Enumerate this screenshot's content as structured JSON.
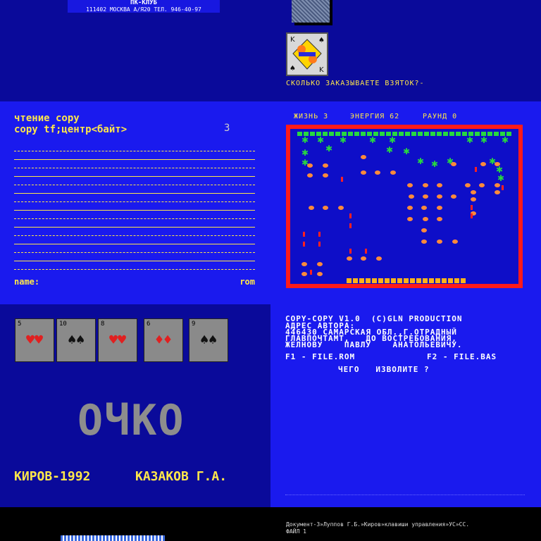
{
  "panel_pkclub": {
    "title": "ПК-КЛУБ",
    "address": "111402 МОСКВА А/Я20  ТЕЛ. 946-40-97"
  },
  "panel_preferans": {
    "prompt": "СКОЛЬКО ЗАКАЗЫВАЕТЕ ВЗЯТОК?-"
  },
  "panel_copy": {
    "line1": "чтение  copy",
    "line2": "copy tf;центр<байт>",
    "cursor": "3",
    "name_label": "name:",
    "rom_label": "rom"
  },
  "panel_game": {
    "lives": "ЖИЗНЬ 3",
    "energy": "ЭНЕРГИЯ 62",
    "round": "РАУНД  0"
  },
  "panel_ochko": {
    "cards": [
      {
        "rank": "5",
        "suit": "♥",
        "color": "#e02020"
      },
      {
        "rank": "10",
        "suit": "♠",
        "color": "#111111"
      },
      {
        "rank": "8",
        "suit": "♥",
        "color": "#e02020"
      },
      {
        "rank": "6",
        "suit": "♦",
        "color": "#e02020"
      },
      {
        "rank": "9",
        "suit": "♠",
        "color": "#111111"
      }
    ],
    "title": "ОЧКО",
    "city_year": "КИРОВ-1992",
    "author": "КАЗАКОВ Г.А."
  },
  "panel_copycopy": {
    "line1": "COPY-COPY V1.0  (C)GLN PRODUCTION",
    "line2": "АДРЕС АВТОРА:",
    "line3": "446430 САМАРСКАЯ ОБЛ.,Г.ОТРАДНЫЙ",
    "line4": "ГЛАВПОЧТАМТ,   ДО ВОСТРЕБОВАНИЯ,",
    "line5": "ЖЕЛНОВУ    ПАВЛУ    АНАТОЛЬЕВИЧУ.",
    "f1": "F1 - FILE.ROM",
    "f2": "F2 - FILE.BAS",
    "ask": "ЧЕГО   ИЗВОЛИТЕ ?"
  },
  "panel_doc": {
    "line1": "Документ-3»Луппов Г.Б.»Киров»клавиши управления»УС»СС.",
    "line2": "ФАЙЛ 1"
  },
  "colors": {
    "yellow": "#ffe74a",
    "blue": "#1a1aee",
    "dark_blue": "#0a0a9a",
    "red": "#ff1a1a",
    "green": "#27d840"
  }
}
